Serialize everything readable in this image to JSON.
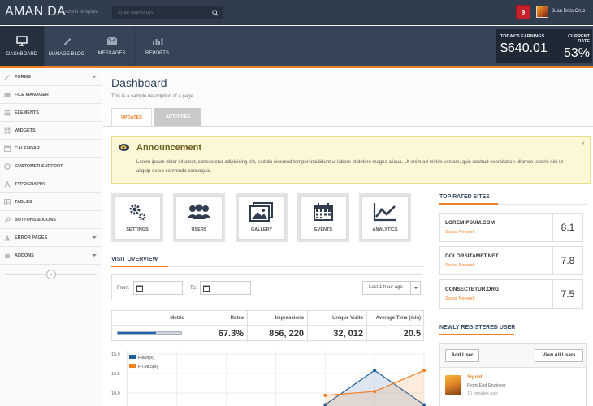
{
  "header": {
    "logo_main": "AMAN",
    "logo_dot": ".",
    "logo_tail": "DA",
    "logo_sub": "admin template",
    "search_placeholder": "Enter keyword(s)",
    "notifications": "9",
    "username": "Juan Dela Cruz"
  },
  "nav": {
    "items": [
      {
        "label": "DASHBOARD",
        "icon": "monitor-icon",
        "active": true
      },
      {
        "label": "MANAGE BLOG",
        "icon": "pencil-icon"
      },
      {
        "label": "MESSAGES",
        "icon": "envelope-icon"
      },
      {
        "label": "REPORTS",
        "icon": "bar-chart-icon"
      }
    ],
    "earnings_label": "TODAY'S EARNINGS",
    "earnings_value": "$640.01",
    "rate_label": "CURRENT RATE",
    "rate_value": "53%"
  },
  "sidebar": {
    "items": [
      {
        "label": "FORMS",
        "icon": "pencil-icon",
        "has_caret": true
      },
      {
        "label": "FILE MANAGER",
        "icon": "folder-icon"
      },
      {
        "label": "ELEMENTS",
        "icon": "list-icon"
      },
      {
        "label": "WIDGETS",
        "icon": "grid-icon"
      },
      {
        "label": "CALENDAR",
        "icon": "calendar-icon"
      },
      {
        "label": "CUSTOMER SUPPORT",
        "icon": "lifebuoy-icon"
      },
      {
        "label": "TYPOGRAPHY",
        "icon": "font-icon"
      },
      {
        "label": "TABLES",
        "icon": "table-icon"
      },
      {
        "label": "BUTTONS & ICONS",
        "icon": "wrench-icon"
      },
      {
        "label": "ERROR PAGES",
        "icon": "warning-icon",
        "has_caret": true
      },
      {
        "label": "ADDONS",
        "icon": "plugin-icon",
        "has_caret": true
      }
    ],
    "collapse_glyph": "‹"
  },
  "page": {
    "title": "Dashboard",
    "description": "This is a sample description of a page",
    "tabs": [
      "UPDATES",
      "ACTIVITIES"
    ]
  },
  "announcement": {
    "title": "Announcement",
    "text": "Lorem ipsum dolor sit amet, consectetur adipisicing elit, sed do eiusmod tempor incididunt ut labore et dolore magna aliqua. Ut enim ad minim veniam, quis nostrud exercitation ullamco laboris nisi ut aliquip ex ea commodo consequat.",
    "close": "×"
  },
  "shortcuts": [
    {
      "label": "SETTINGS",
      "icon": "gears-icon"
    },
    {
      "label": "USERS",
      "icon": "users-icon"
    },
    {
      "label": "GALLERY",
      "icon": "picture-icon"
    },
    {
      "label": "EVENTS",
      "icon": "calendar-icon"
    },
    {
      "label": "ANALYTICS",
      "icon": "line-chart-icon"
    }
  ],
  "visit": {
    "title": "VISIT OVERVIEW",
    "from_label": "From:",
    "to_label": "To:",
    "range_select": "Last 1 hour ago",
    "columns": [
      "Metric",
      "Rates",
      "Impressions",
      "Unique Visits",
      "Average Time (min)"
    ],
    "values": [
      "",
      "67.3%",
      "856, 220",
      "32, 012",
      "20.5"
    ],
    "metric_progress": 0.6
  },
  "chart_data": {
    "type": "area",
    "x": [
      0,
      1,
      2,
      3,
      4,
      5,
      6
    ],
    "y_ticks": [
      "15.0",
      "12.5",
      "10.0"
    ],
    "ylim": [
      7.5,
      15.0
    ],
    "series": [
      {
        "name": "Flash(x)",
        "color": "#1f5f9e",
        "values": [
          null,
          null,
          null,
          null,
          8.5,
          12.9,
          8.5
        ]
      },
      {
        "name": "HTML5(x)",
        "color": "#f07f24",
        "values": [
          null,
          null,
          null,
          null,
          9.7,
          10.2,
          12.9
        ]
      }
    ]
  },
  "top_rated": {
    "title": "TOP RATED SITES",
    "sites": [
      {
        "name": "LOREMIPSUM.COM",
        "category": "Social Network",
        "score": "8.1"
      },
      {
        "name": "DOLORSITAMET.NET",
        "category": "Social Network",
        "score": "7.8"
      },
      {
        "name": "CONSECTETUR.ORG",
        "category": "Social Network",
        "score": "7.5"
      }
    ]
  },
  "new_users": {
    "title": "NEWLY REGISTERED USER",
    "add_button": "Add User",
    "view_button": "View All Users",
    "users": [
      {
        "name": "Squint",
        "role": "Front-End Engineer",
        "time": "10 minutes ago"
      }
    ]
  },
  "colors": {
    "accent": "#f07f24",
    "nav_bg": "#354457",
    "top_bg": "#2f3d4f",
    "badge": "#c8202a"
  }
}
